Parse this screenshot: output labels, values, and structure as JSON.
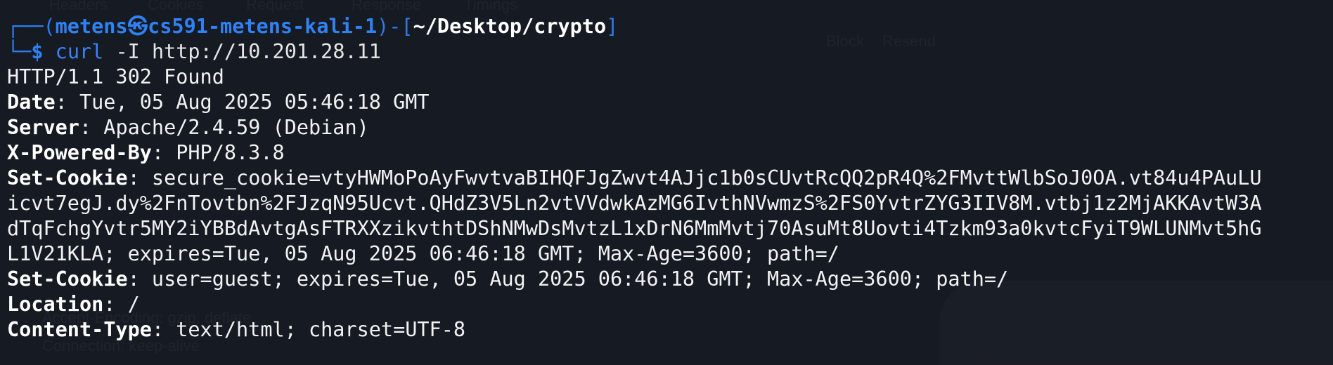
{
  "background_ui": {
    "tabs": [
      "Headers",
      "Cookies",
      "Request",
      "Response",
      "Timings"
    ],
    "actions": [
      "Block",
      "Resend"
    ],
    "hint_1": "Accept-Encoding: gzip, deflate",
    "hint_2": "Connection: keep-alive"
  },
  "prompt": {
    "frame_open": "┌──(",
    "user": "metens",
    "at_symbol": "㉿",
    "host": "cs591-metens-kali-1",
    "frame_mid": ")-[",
    "path": "~/Desktop/crypto",
    "frame_close": "]",
    "frame_bottom": "└─",
    "dollar": "$"
  },
  "command": {
    "program": "curl",
    "args": "-I http://10.201.28.11"
  },
  "response": {
    "status_line": "HTTP/1.1 302 Found",
    "headers": [
      {
        "key": "Date",
        "value": "Tue, 05 Aug 2025 05:46:18 GMT"
      },
      {
        "key": "Server",
        "value": "Apache/2.4.59 (Debian)"
      },
      {
        "key": "X-Powered-By",
        "value": "PHP/8.3.8"
      },
      {
        "key": "Set-Cookie",
        "value": "secure_cookie=vtyHWMoPoAyFwvtvaBIHQFJgZwvt4AJjc1b0sCUvtRcQQ2pR4Q%2FMvttWlbSoJ0OA.vt84u4PAuLU"
      },
      {
        "key": "Set-Cookie",
        "value": "user=guest; expires=Tue, 05 Aug 2025 06:46:18 GMT; Max-Age=3600; path=/"
      },
      {
        "key": "Location",
        "value": "/"
      },
      {
        "key": "Content-Type",
        "value": "text/html; charset=UTF-8"
      }
    ],
    "cookie_continuation": [
      "icvt7egJ.dy%2FnTovtbn%2FJzqN95Ucvt.QHdZ3V5Ln2vtVVdwkAzMG6IvthNVwmzS%2FS0YvtrZYG3IIV8M.vtbj1z2MjAKKAvtW3A",
      "dTqFchgYvtr5MY2iYBBdAvtgAsFTRXXzikvthtDShNMwDsMvtzL1xDrN6MmMvtj70AsuMt8Uovti4Tzkm93a0kvtcFyiT9WLUNMvt5hG",
      "L1V21KLA; expires=Tue, 05 Aug 2025 06:46:18 GMT; Max-Age=3600; path=/"
    ]
  },
  "colors": {
    "background": "#161a22",
    "prompt_blue": "#2f82f4",
    "text": "#ffffff"
  }
}
